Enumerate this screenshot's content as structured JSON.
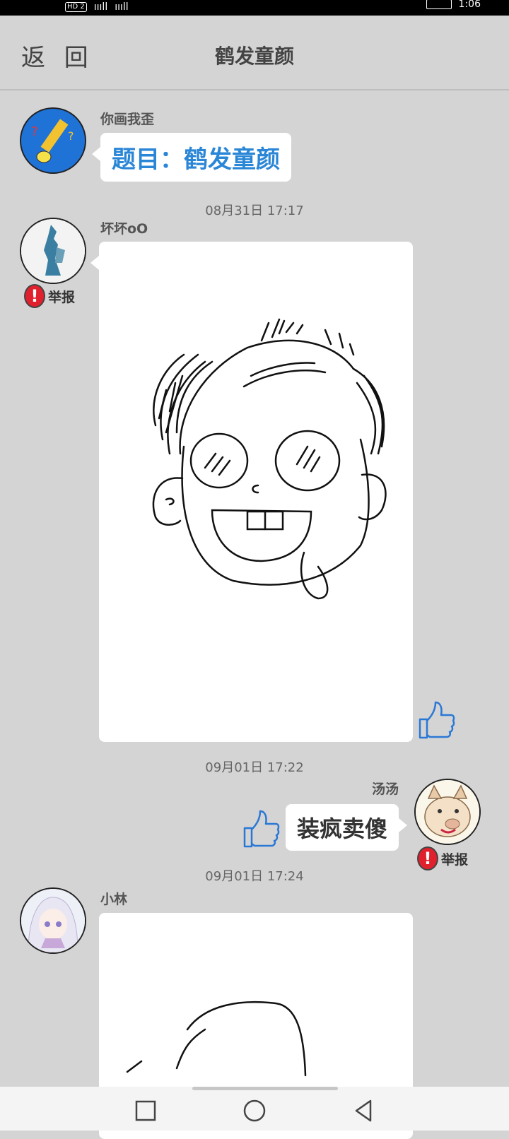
{
  "status_bar": {
    "hd_badge": "HD 2",
    "signal_1": "ıııll",
    "signal_2": "ıııll",
    "clock": "1:06"
  },
  "header": {
    "back_label": "返 回",
    "title": "鹤发童颜"
  },
  "messages": {
    "topic": {
      "sender": "你画我歪",
      "text": "题目：鹤发童颜"
    },
    "time_1": "08月31日  17:17",
    "drawing_1": {
      "sender": "坏坏oO",
      "report_label": "举报"
    },
    "time_2": "09月01日  17:22",
    "guess_1": {
      "sender": "汤汤",
      "text": "装疯卖傻",
      "report_label": "举报"
    },
    "time_3": "09月01日  17:24",
    "drawing_2": {
      "sender": "小林"
    }
  },
  "colors": {
    "topic_text": "#2a86d6",
    "report_red": "#e0202d",
    "thumb_blue": "#2a78d6",
    "background": "#d4d4d4"
  },
  "icons": [
    "pencil-avatar-icon",
    "report-icon",
    "thumbs-up-icon",
    "recent-apps-icon",
    "home-icon",
    "back-icon"
  ]
}
